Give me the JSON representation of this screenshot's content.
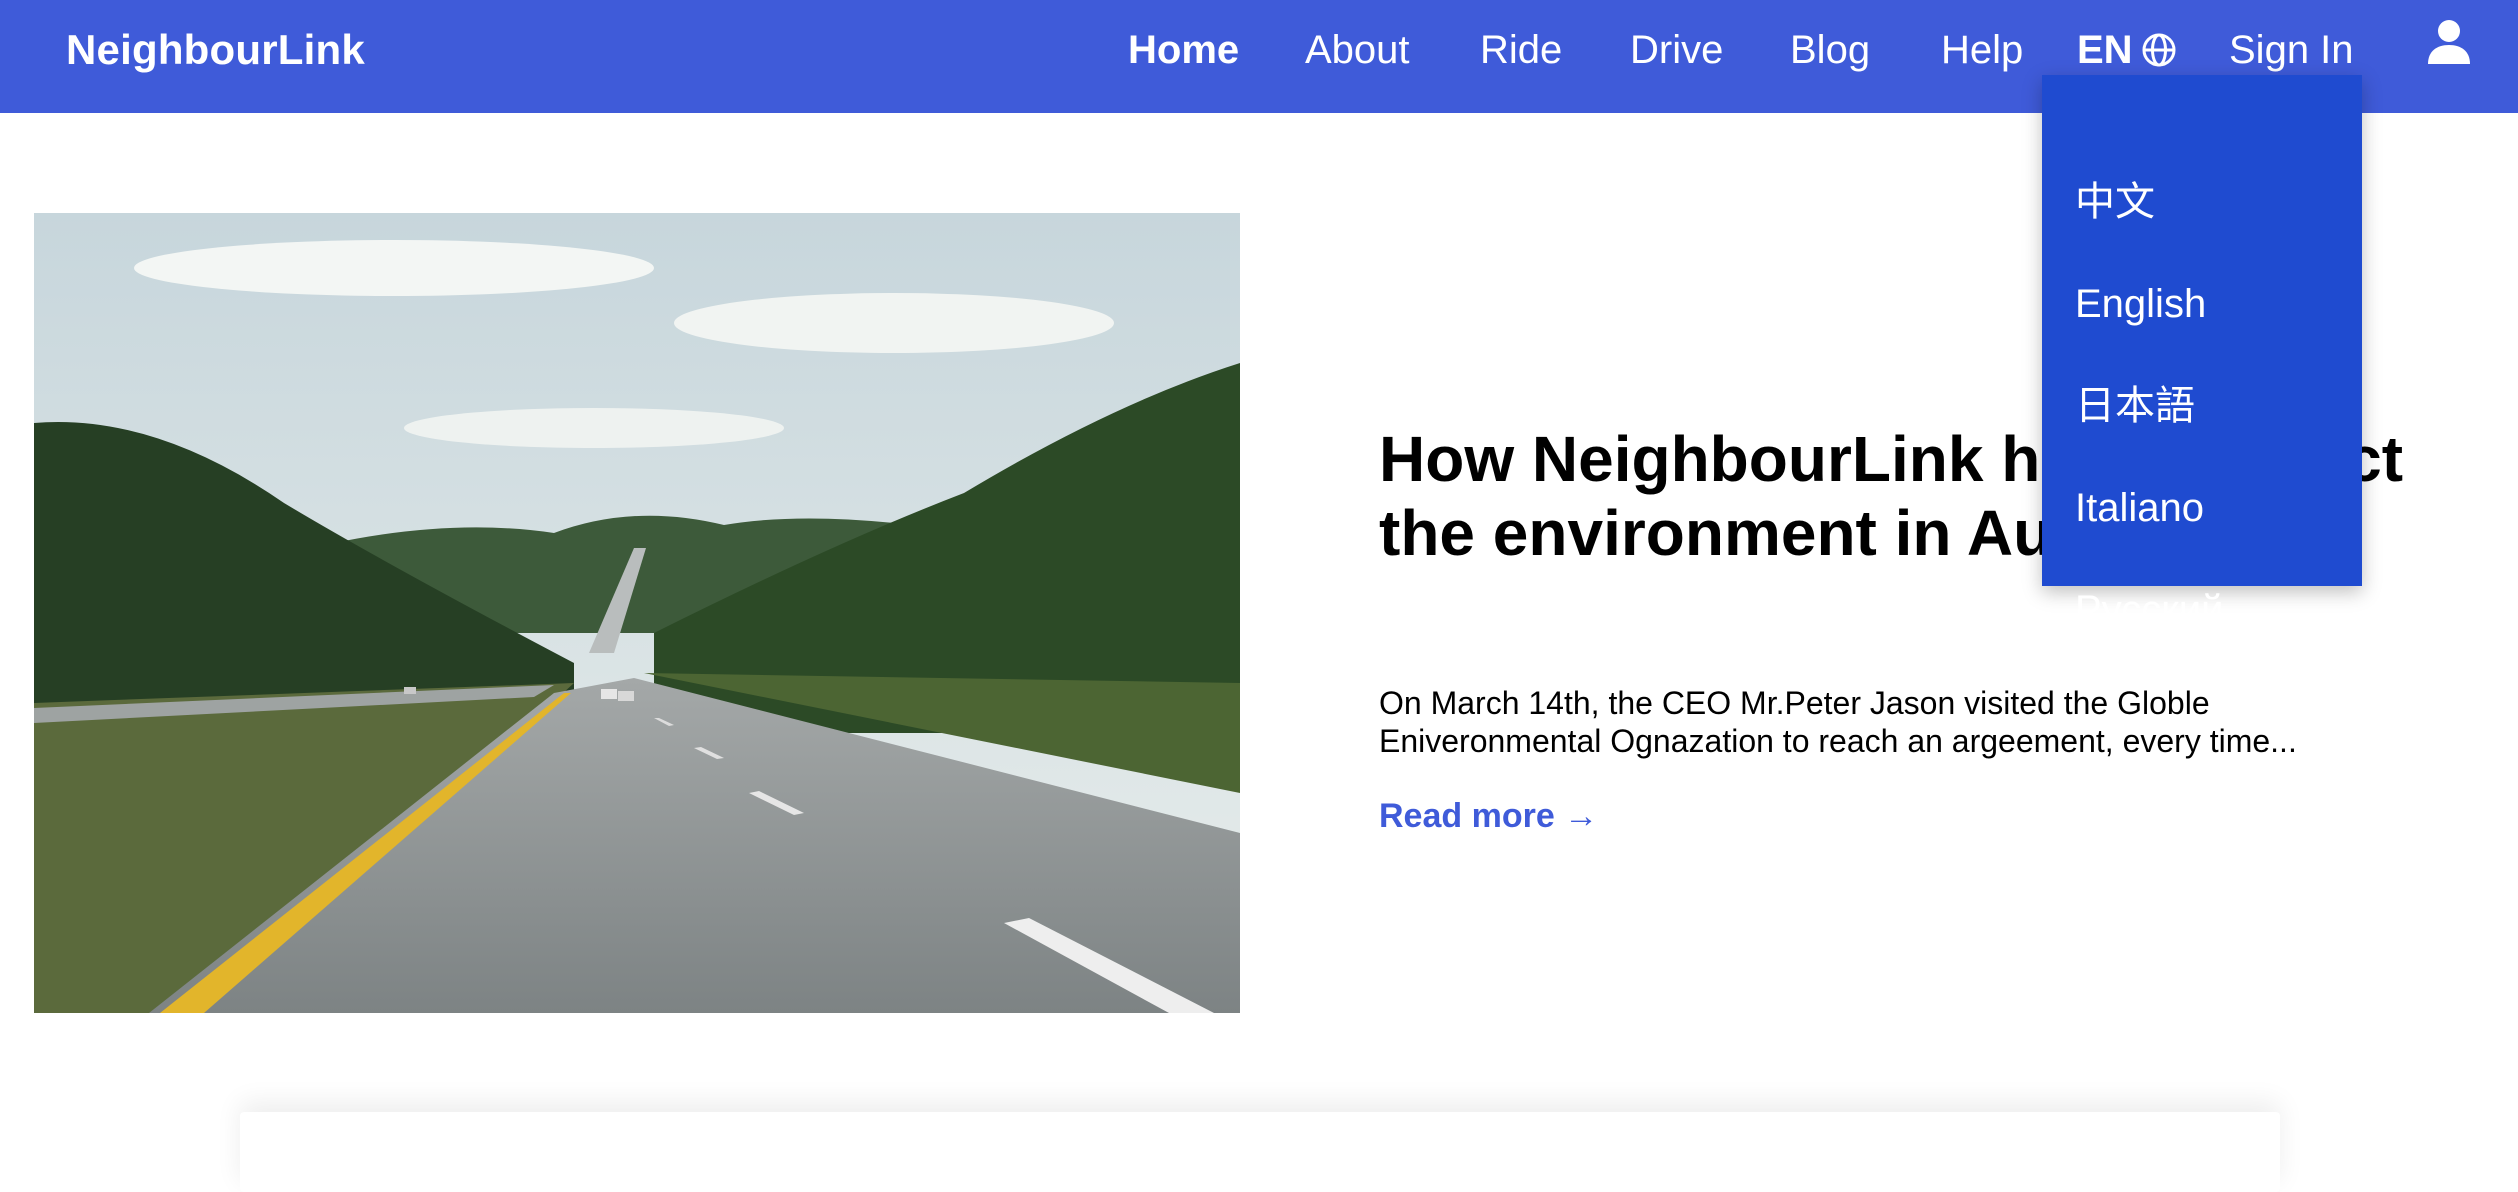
{
  "nav": {
    "brand": "NeighbourLink",
    "links": [
      "Home",
      "About",
      "Ride",
      "Drive",
      "Blog",
      "Help"
    ],
    "language": "EN",
    "sign_in": "Sign In"
  },
  "language_menu": {
    "options": [
      "中文",
      "English",
      "日本語",
      "Italiano",
      "Русский"
    ]
  },
  "article": {
    "title": "How NeighbourLink helps protect the environment in Australia",
    "excerpt": "On March 14th, the CEO Mr.Peter Jason visited the Globle Eniveronmental Ognazation to reach an argeement, every time...",
    "read_more": "Read more →"
  },
  "icons": {
    "language": "globe-icon",
    "account": "user-icon"
  },
  "colors": {
    "nav_background": "#3f5bd9",
    "dropdown_background": "#1f4bd0",
    "link_accent": "#3f5bd9"
  }
}
